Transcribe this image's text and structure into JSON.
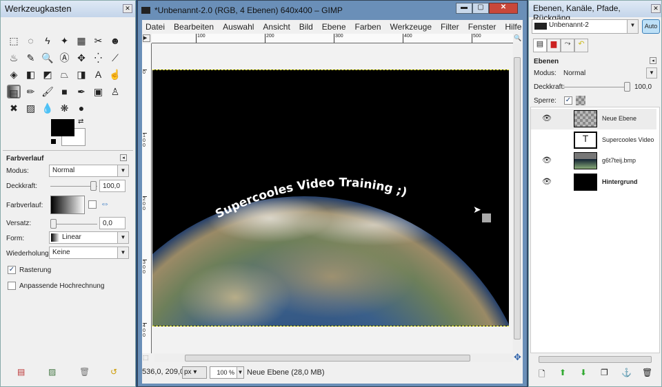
{
  "toolbox": {
    "title": "Werkzeugkasten",
    "close": "✕",
    "tools": [
      "⬚",
      "◌",
      "ϟ",
      "✦",
      "▦",
      "✂",
      "☻",
      "♨",
      "✎",
      "🔍",
      "Ⓐ",
      "✥",
      "⁛",
      "⟋",
      "◈",
      "◧",
      "◩",
      "⏢",
      "◨",
      "A",
      "☝",
      "▤",
      "✏",
      "🖌",
      "■",
      "✒",
      "▣",
      "♙",
      "✖",
      "▨",
      "💧",
      "❋",
      "●"
    ],
    "options": {
      "title": "Farbverlauf",
      "mode_label": "Modus:",
      "mode_value": "Normal",
      "opacity_label": "Deckkraft:",
      "opacity_value": "100,0",
      "opacity": 100,
      "gradient_label": "Farbverlauf:",
      "offset_label": "Versatz:",
      "offset_value": "0,0",
      "shape_label": "Form:",
      "shape_value": "Linear",
      "repeat_label": "Wiederholung:",
      "repeat_value": "Keine",
      "raster_label": "Rasterung",
      "raster_checked": true,
      "adaptive_label": "Anpassende Hochrechnung",
      "adaptive_checked": false
    }
  },
  "image_window": {
    "title": "*Unbenannt-2.0 (RGB, 4 Ebenen) 640x400 – GIMP",
    "menu": [
      "Datei",
      "Bearbeiten",
      "Auswahl",
      "Ansicht",
      "Bild",
      "Ebene",
      "Farben",
      "Werkzeuge",
      "Filter",
      "Fenster",
      "Hilfe"
    ],
    "ruler_ticks": [
      "100",
      "200",
      "300",
      "400",
      "500"
    ],
    "vruler_ticks": [
      "0",
      "100",
      "200",
      "300",
      "400"
    ],
    "canvas_text": "Supercooles Video Training ;)",
    "status": {
      "coords": "536,0, 209,0",
      "unit": "px",
      "zoom": "100 %",
      "info": "Neue Ebene (28,0 MB)"
    }
  },
  "layers_panel": {
    "title": "Ebenen, Kanäle, Pfade, Rückgäng...",
    "image_select": "Unbenannt-2",
    "auto_button": "Auto",
    "section": "Ebenen",
    "mode_label": "Modus:",
    "mode_value": "Normal",
    "opacity_label": "Deckkraft:",
    "opacity_value": "100,0",
    "opacity": 100,
    "lock_label": "Sperre:",
    "layers": [
      {
        "name": "Neue Ebene",
        "visible": true,
        "bold": false
      },
      {
        "name": "Supercooles Video",
        "visible": false,
        "bold": false
      },
      {
        "name": "g6t7teij.bmp",
        "visible": true,
        "bold": false
      },
      {
        "name": "Hintergrund",
        "visible": true,
        "bold": true
      }
    ]
  }
}
